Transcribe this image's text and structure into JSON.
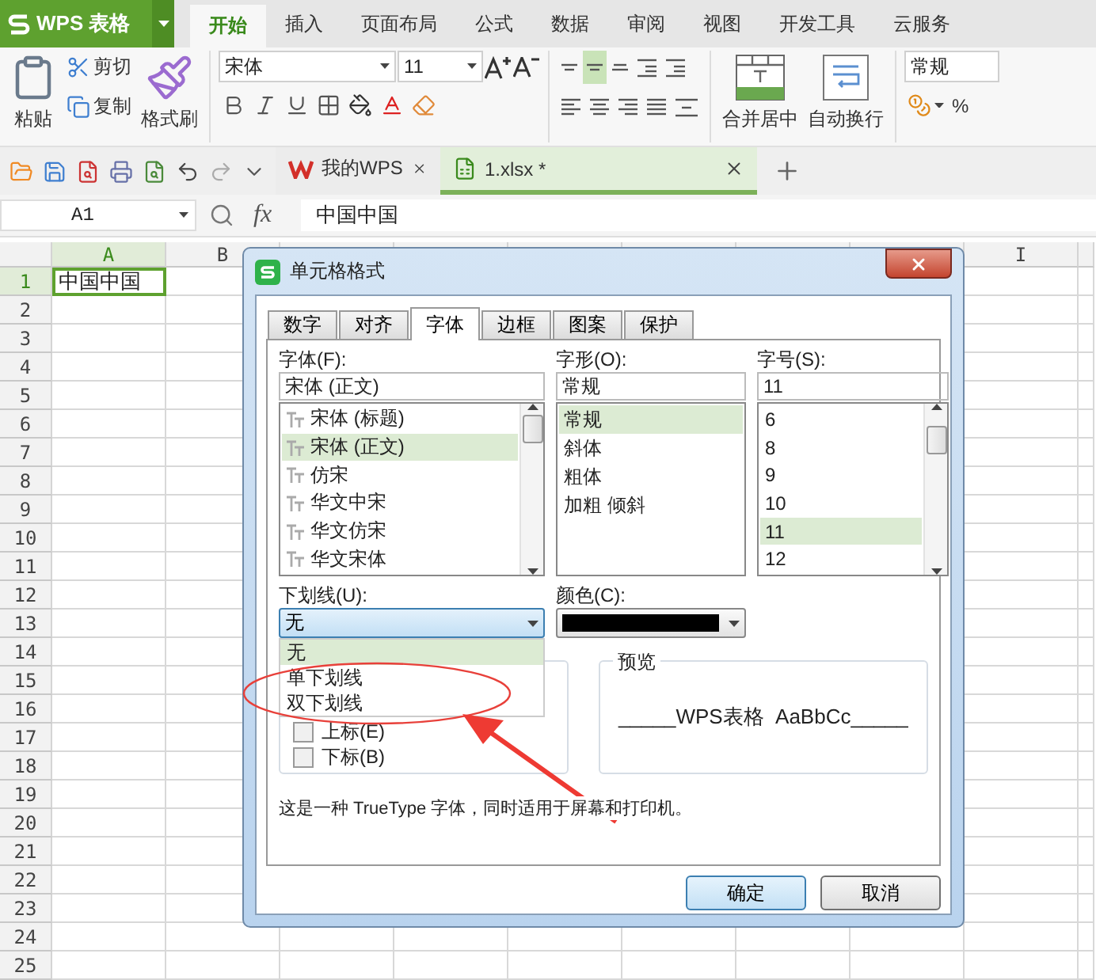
{
  "app_menu": {
    "label": "WPS 表格"
  },
  "ribbon_tabs": [
    {
      "label": "开始",
      "selected": true
    },
    {
      "label": "插入",
      "selected": false
    },
    {
      "label": "页面布局",
      "selected": false
    },
    {
      "label": "公式",
      "selected": false
    },
    {
      "label": "数据",
      "selected": false
    },
    {
      "label": "审阅",
      "selected": false
    },
    {
      "label": "视图",
      "selected": false
    },
    {
      "label": "开发工具",
      "selected": false
    },
    {
      "label": "云服务",
      "selected": false
    }
  ],
  "ribbon": {
    "paste": "粘贴",
    "cut": "剪切",
    "copy": "复制",
    "format_painter": "格式刷",
    "font_name": "宋体",
    "font_size": "11",
    "vertical_align": [
      {
        "kind": "top",
        "selected": false
      },
      {
        "kind": "middle",
        "selected": true
      },
      {
        "kind": "bottom",
        "selected": false
      }
    ],
    "merge_center": "合并居中",
    "wrap_text": "自动换行",
    "number_format": "常规",
    "percent": "%"
  },
  "doc_tabs": [
    {
      "title": "我的WPS",
      "kind": "home",
      "selected": false
    },
    {
      "title": "1.xlsx *",
      "kind": "sheet",
      "selected": true
    }
  ],
  "formula_bar": {
    "name_box": "A1",
    "fx": "fx",
    "value": "中国中国"
  },
  "sheet": {
    "columns": [
      {
        "label": "A",
        "selected": true
      },
      {
        "label": "B",
        "selected": false
      },
      {
        "selected": false
      },
      {
        "selected": false
      },
      {
        "selected": false
      },
      {
        "selected": false
      },
      {
        "selected": false
      },
      {
        "selected": false
      },
      {
        "label": "I",
        "selected": false
      }
    ],
    "rows": [
      {
        "label": "1",
        "selected": true,
        "cells": [
          "中国中国"
        ]
      },
      {
        "label": "2",
        "selected": false
      },
      {
        "label": "3",
        "selected": false
      },
      {
        "label": "4",
        "selected": false
      },
      {
        "label": "5",
        "selected": false
      },
      {
        "label": "6",
        "selected": false
      },
      {
        "label": "7",
        "selected": false
      },
      {
        "label": "8",
        "selected": false
      },
      {
        "label": "9",
        "selected": false
      },
      {
        "label": "10",
        "selected": false
      },
      {
        "label": "11",
        "selected": false
      },
      {
        "label": "12",
        "selected": false
      },
      {
        "label": "13",
        "selected": false
      },
      {
        "label": "14",
        "selected": false
      },
      {
        "label": "15",
        "selected": false
      },
      {
        "label": "16",
        "selected": false
      },
      {
        "label": "17",
        "selected": false
      },
      {
        "label": "18",
        "selected": false
      },
      {
        "label": "19",
        "selected": false
      },
      {
        "label": "20",
        "selected": false
      },
      {
        "label": "21",
        "selected": false
      },
      {
        "label": "22",
        "selected": false
      },
      {
        "label": "23",
        "selected": false
      },
      {
        "label": "24",
        "selected": false
      },
      {
        "label": "25",
        "selected": false
      }
    ]
  },
  "dialog": {
    "title": "单元格格式",
    "tabs": [
      {
        "label": "数字",
        "selected": false
      },
      {
        "label": "对齐",
        "selected": false
      },
      {
        "label": "字体",
        "selected": true
      },
      {
        "label": "边框",
        "selected": false
      },
      {
        "label": "图案",
        "selected": false
      },
      {
        "label": "保护",
        "selected": false
      }
    ],
    "font": {
      "label": "字体(F):",
      "value": "宋体 (正文)",
      "options": [
        {
          "label": "宋体 (标题)",
          "selected": false
        },
        {
          "label": "宋体 (正文)",
          "selected": true
        },
        {
          "label": "仿宋",
          "selected": false
        },
        {
          "label": "华文中宋",
          "selected": false
        },
        {
          "label": "华文仿宋",
          "selected": false
        },
        {
          "label": "华文宋体",
          "selected": false
        }
      ]
    },
    "style": {
      "label": "字形(O):",
      "value": "常规",
      "options": [
        {
          "label": "常规",
          "selected": true
        },
        {
          "label": "斜体",
          "selected": false
        },
        {
          "label": "粗体",
          "selected": false
        },
        {
          "label": "加粗 倾斜",
          "selected": false
        }
      ]
    },
    "size": {
      "label": "字号(S):",
      "value": "11",
      "options": [
        {
          "label": "6",
          "selected": false
        },
        {
          "label": "8",
          "selected": false
        },
        {
          "label": "9",
          "selected": false
        },
        {
          "label": "10",
          "selected": false
        },
        {
          "label": "11",
          "selected": true
        },
        {
          "label": "12",
          "selected": false
        }
      ]
    },
    "underline": {
      "label": "下划线(U):",
      "value": "无",
      "expanded": true,
      "options": [
        {
          "label": "无",
          "selected": true
        },
        {
          "label": "单下划线",
          "selected": false
        },
        {
          "label": "双下划线",
          "selected": false
        }
      ]
    },
    "color": {
      "label": "颜色(C):",
      "color": "#000000"
    },
    "effects": [
      {
        "label": "上标(E)",
        "checked": false
      },
      {
        "label": "下标(B)",
        "checked": false
      }
    ],
    "preview": {
      "label": "预览",
      "text": "_____WPS表格  AaBbCc_____"
    },
    "description": "这是一种 TrueType 字体，同时适用于屏幕和打印机。",
    "buttons": [
      {
        "label": "确定",
        "kind": "primary"
      },
      {
        "label": "取消",
        "kind": "secondary"
      }
    ]
  }
}
